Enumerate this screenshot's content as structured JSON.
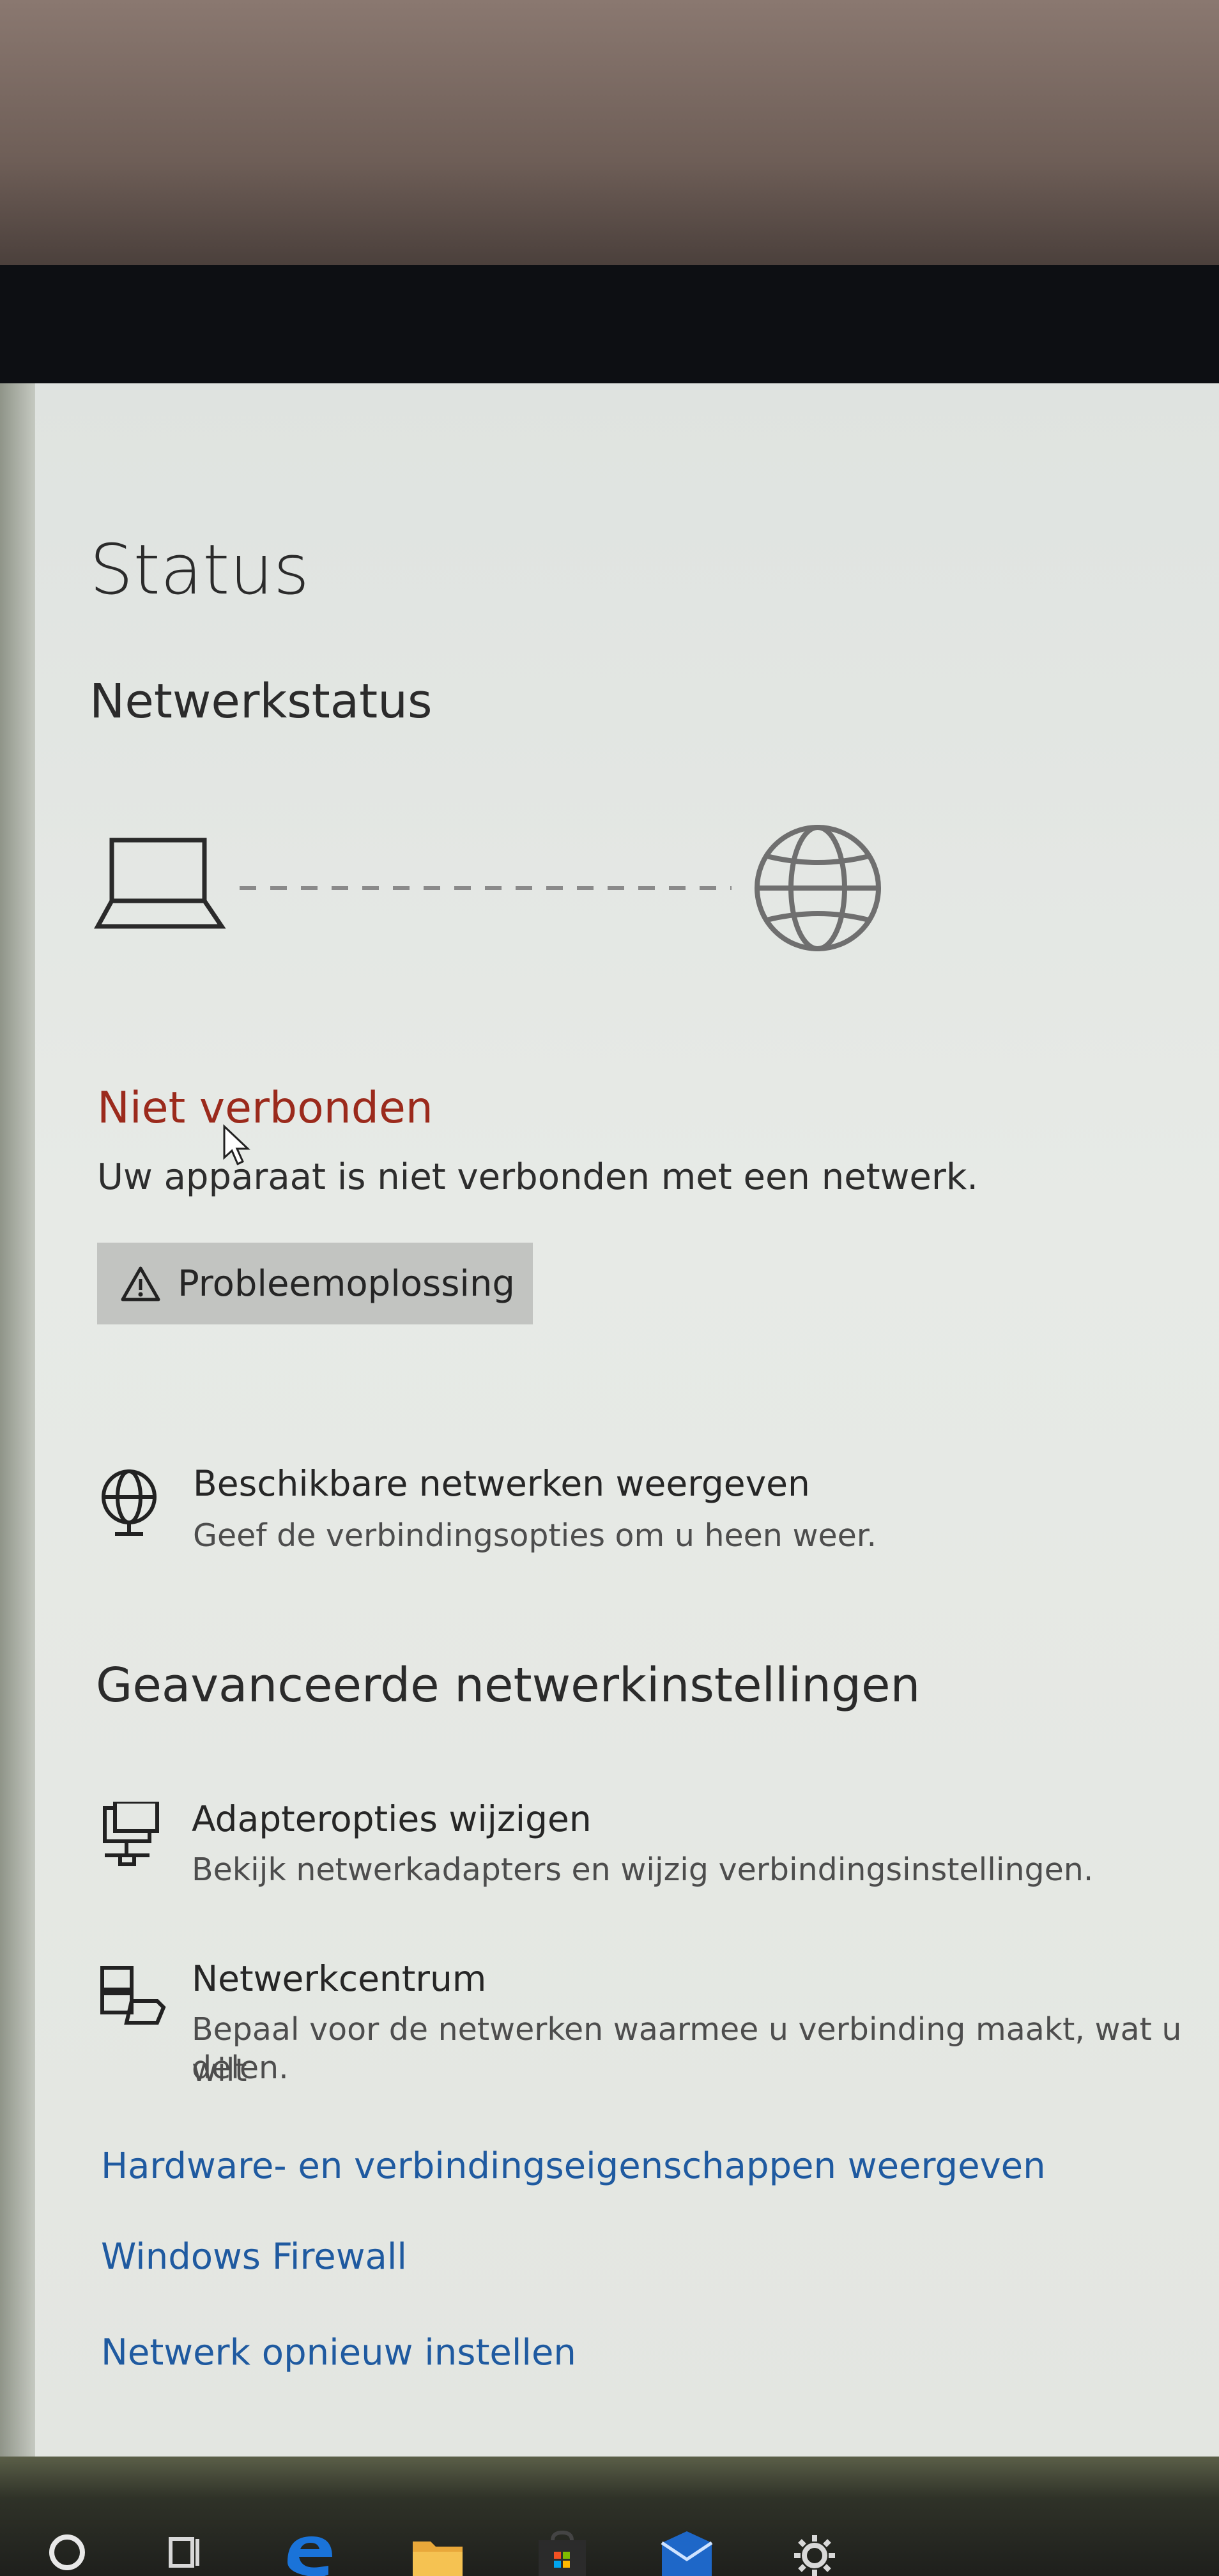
{
  "page": {
    "title": "Status",
    "section_heading": "Netwerkstatus",
    "status_text": "Niet verbonden",
    "status_description": "Uw apparaat is niet verbonden met een netwerk.",
    "troubleshoot_label": "Probleemoplossing"
  },
  "networks_item": {
    "title": "Beschikbare netwerken weergeven",
    "subtitle": "Geef de verbindingsopties om u heen weer."
  },
  "advanced": {
    "heading": "Geavanceerde netwerkinstellingen",
    "items": [
      {
        "title": "Adapteropties wijzigen",
        "subtitle": "Bekijk netwerkadapters en wijzig verbindingsinstellingen."
      },
      {
        "title": "Netwerkcentrum",
        "subtitle_line1": "Bepaal voor de netwerken waarmee u verbinding maakt, wat u wilt",
        "subtitle_line2": "delen."
      }
    ]
  },
  "links": [
    "Hardware- en verbindingseigenschappen weergeven",
    "Windows Firewall",
    "Netwerk opnieuw instellen"
  ],
  "colors": {
    "error": "#9b2a1c",
    "link": "#1f5aa0",
    "button": "#c2c4c1"
  },
  "taskbar_icons": [
    "search-circle-icon",
    "task-view-icon",
    "edge-icon",
    "file-explorer-icon",
    "store-icon",
    "mail-icon",
    "settings-gear-icon"
  ]
}
